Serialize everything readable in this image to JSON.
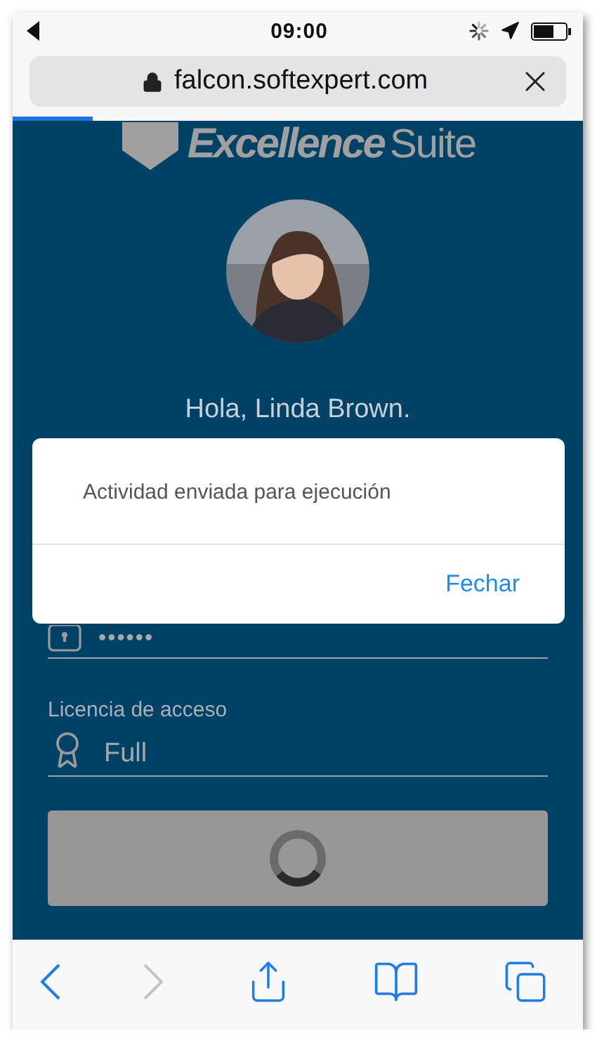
{
  "status_bar": {
    "time": "09:00"
  },
  "address_bar": {
    "url": "falcon.softexpert.com"
  },
  "page_load": {
    "level": 0.14
  },
  "logo": {
    "bold": "Excellence",
    "light": "Suite"
  },
  "greeting": "Hola, Linda Brown.",
  "password": {
    "value": "••••••"
  },
  "license": {
    "label": "Licencia de acceso",
    "value": "Full"
  },
  "submit": {
    "loading": true
  },
  "alert": {
    "message": "Actividad enviada para ejecución",
    "button": "Fechar"
  },
  "toolbar": [
    {
      "kind": "back",
      "disabled": false
    },
    {
      "kind": "forward",
      "disabled": true
    },
    {
      "kind": "share",
      "disabled": false
    },
    {
      "kind": "bookmarks",
      "disabled": false
    },
    {
      "kind": "tabs",
      "disabled": false
    }
  ]
}
